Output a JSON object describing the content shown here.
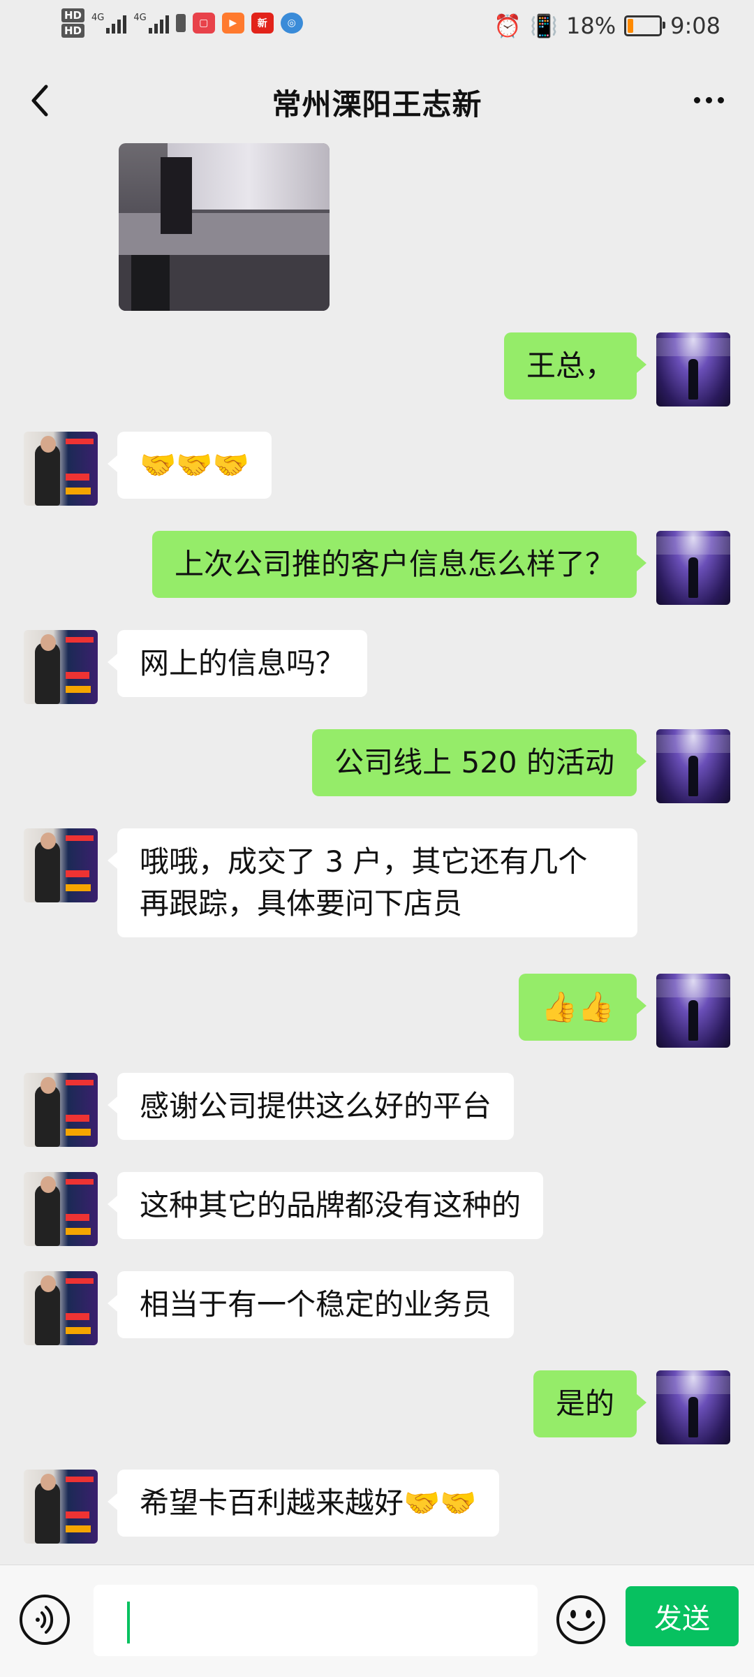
{
  "status_bar": {
    "hd1": "HD",
    "hd2": "HD",
    "signal1_label": "4G",
    "signal2_label": "4G",
    "battery_percent": "18%",
    "battery_level": 0.18,
    "battery_color": "#ff8a00",
    "time": "9:08",
    "app_icons": [
      "alarm-icon",
      "vibrate-icon"
    ]
  },
  "header": {
    "title": "常州溧阳王志新",
    "back_icon": "chevron-left-icon",
    "more_icon": "more-dots-icon"
  },
  "messages": [
    {
      "side": "right",
      "text": "王总，"
    },
    {
      "side": "left",
      "text": "🤝🤝🤝"
    },
    {
      "side": "right",
      "text": "上次公司推的客户信息怎么样了？"
    },
    {
      "side": "left",
      "text": "网上的信息吗？"
    },
    {
      "side": "right",
      "text": "公司线上 520 的活动"
    },
    {
      "side": "left",
      "line1": "哦哦，成交了 3 户，其它还有几个",
      "line2": "再跟踪，具体要问下店员"
    },
    {
      "side": "right",
      "text": "👍👍"
    },
    {
      "side": "left",
      "text": "感谢公司提供这么好的平台"
    },
    {
      "side": "left",
      "text": "这种其它的品牌都没有这种的"
    },
    {
      "side": "left",
      "text": "相当于有一个稳定的业务员"
    },
    {
      "side": "right",
      "text": "是的"
    },
    {
      "side": "left",
      "text": "希望卡百利越来越好🤝🤝"
    }
  ],
  "input_bar": {
    "value": "",
    "send_label": "发送",
    "voice_icon": "voice-icon",
    "emoji_icon": "emoji-icon"
  },
  "colors": {
    "background": "#ededed",
    "bubble_self": "#95ec69",
    "bubble_other": "#ffffff",
    "accent": "#07c160"
  }
}
